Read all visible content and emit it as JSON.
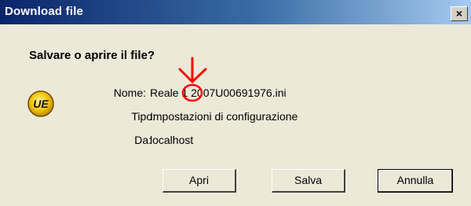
{
  "window": {
    "title": "Download file",
    "close_symbol": "×"
  },
  "dialog": {
    "prompt": "Salvare o aprire il file?",
    "icon": {
      "name": "ultraedit-icon",
      "text": "UE"
    },
    "fields": {
      "nome_label": "Nome:",
      "nome_value": "Reale 1 2007U00691976.ini",
      "tipo_label": "Tipo:",
      "tipo_value": "Impostazioni di configurazione",
      "da_label": "Da:",
      "da_value": "localhost"
    }
  },
  "buttons": {
    "apri": "Apri",
    "salva": "Salva",
    "annulla": "Annulla"
  },
  "annotation": {
    "color": "#ff0000",
    "type": "red-arrow-and-circle"
  }
}
